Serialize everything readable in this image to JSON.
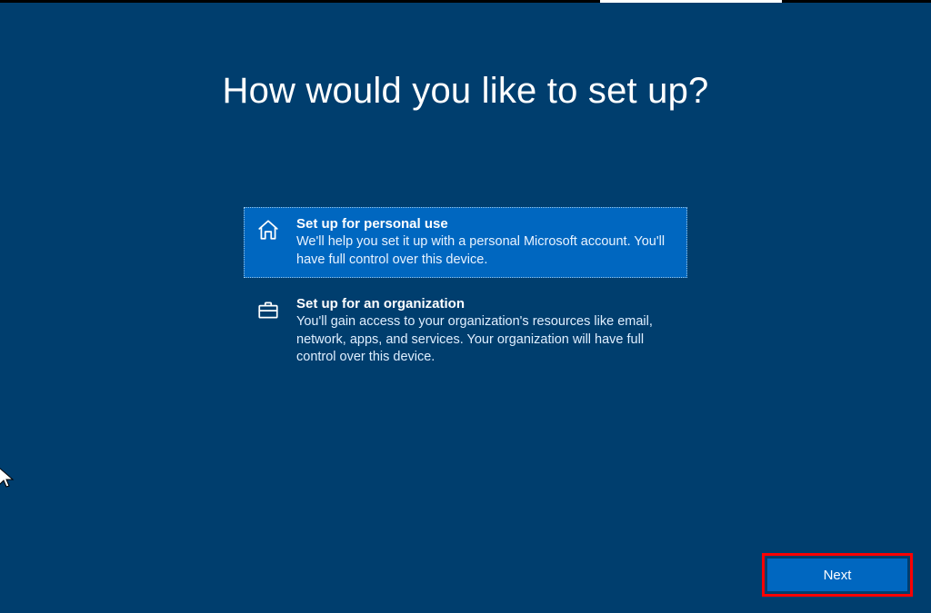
{
  "title": "How would you like to set up?",
  "options": {
    "personal": {
      "heading": "Set up for personal use",
      "body": "We'll help you set it up with a personal Microsoft account. You'll have full control over this device.",
      "icon": "home-icon",
      "selected": true
    },
    "organization": {
      "heading": "Set up for an organization",
      "body": "You'll gain access to your organization's resources like email, network, apps, and services. Your organization will have full control over this device.",
      "icon": "briefcase-icon",
      "selected": false
    }
  },
  "next_label": "Next",
  "colors": {
    "bg": "#003e6e",
    "accent": "#0067c0",
    "highlight": "#ff0000"
  }
}
